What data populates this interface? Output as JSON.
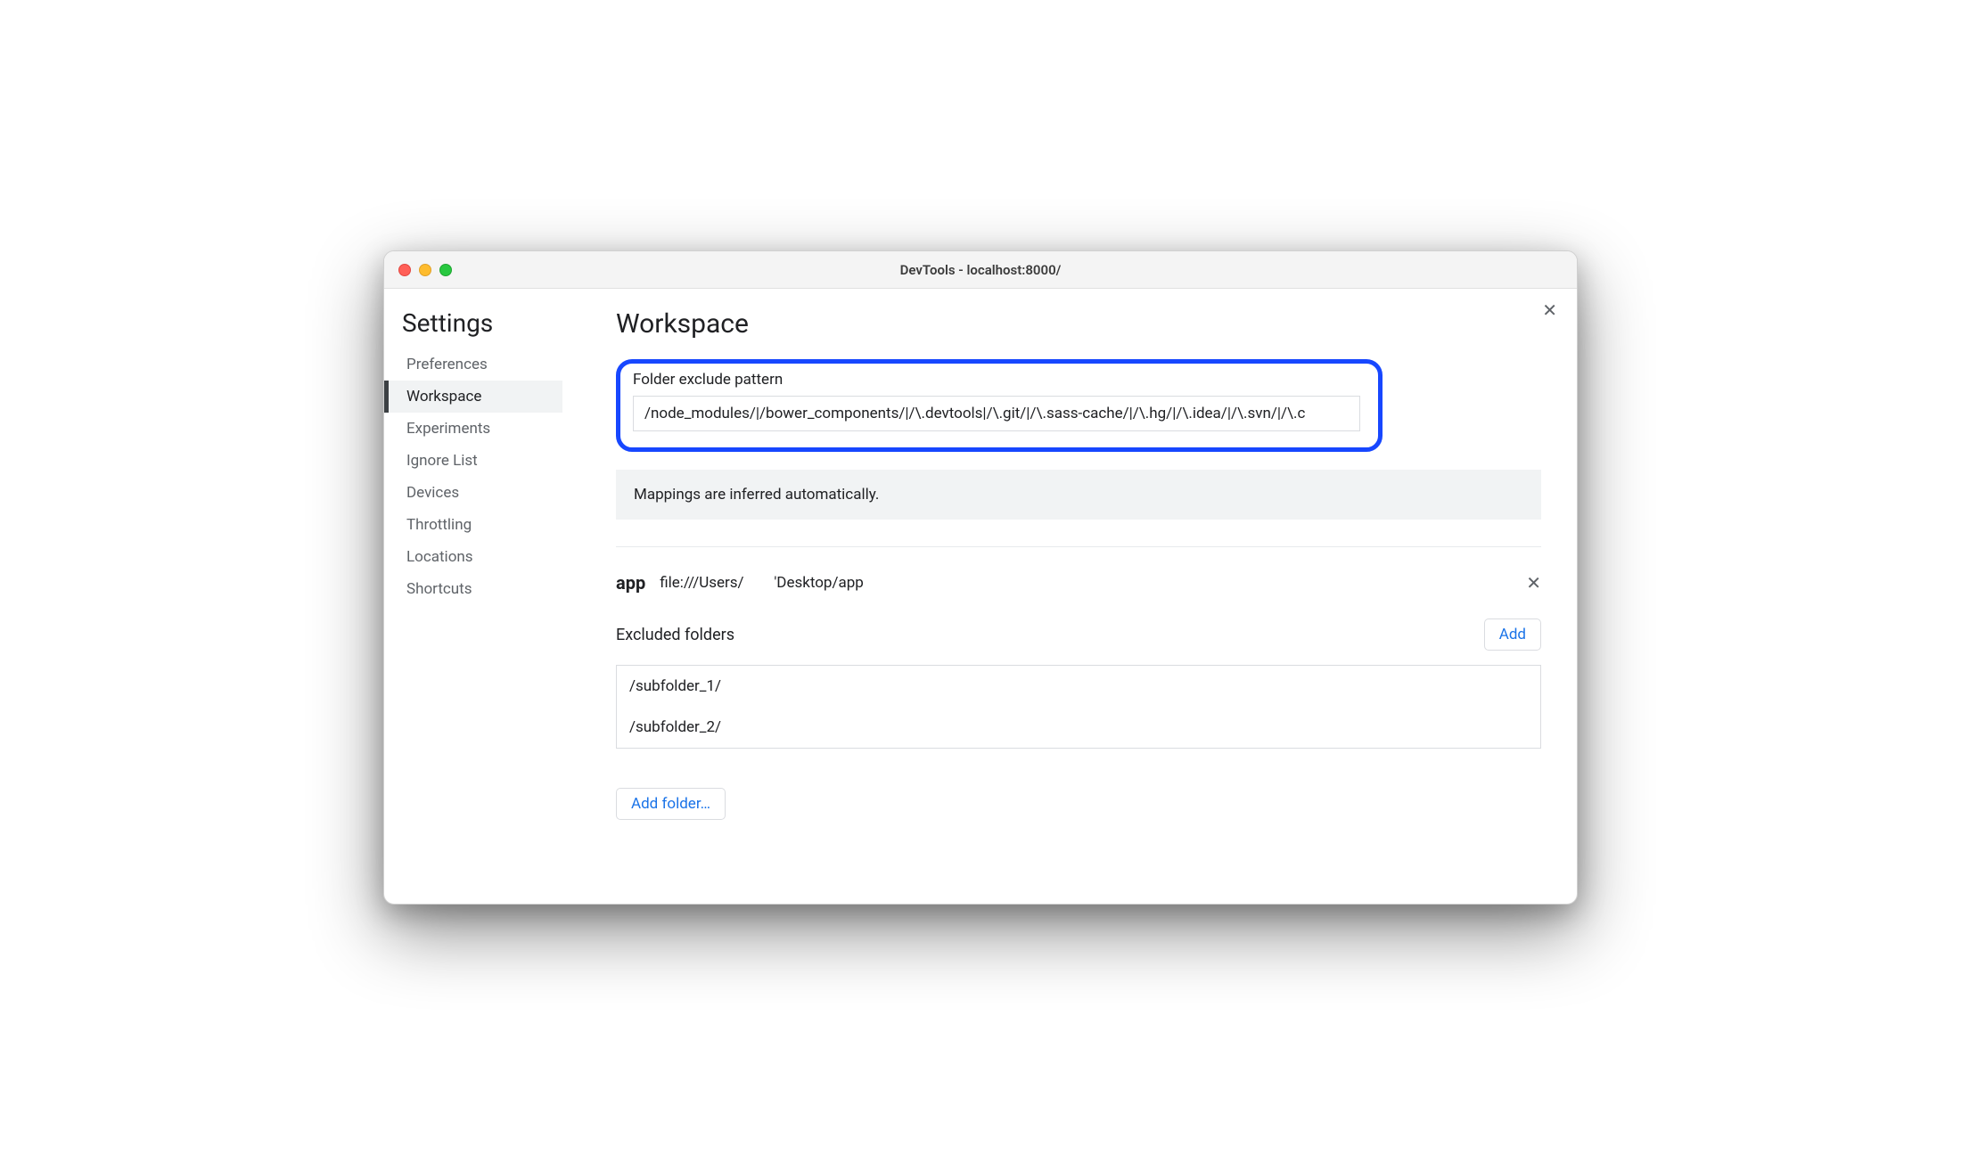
{
  "window": {
    "title": "DevTools - localhost:8000/"
  },
  "sidebar": {
    "title": "Settings",
    "items": [
      {
        "label": "Preferences"
      },
      {
        "label": "Workspace"
      },
      {
        "label": "Experiments"
      },
      {
        "label": "Ignore List"
      },
      {
        "label": "Devices"
      },
      {
        "label": "Throttling"
      },
      {
        "label": "Locations"
      },
      {
        "label": "Shortcuts"
      }
    ]
  },
  "main": {
    "title": "Workspace",
    "exclude_pattern_label": "Folder exclude pattern",
    "exclude_pattern_value": "/node_modules/|/bower_components/|/\\.devtools|/\\.git/|/\\.sass-cache/|/\\.hg/|/\\.idea/|/\\.svn/|/\\.c",
    "info_message": "Mappings are inferred automatically.",
    "folder": {
      "name": "app",
      "path_prefix": "file:///Users/",
      "path_suffix": "'Desktop/app"
    },
    "excluded_folders_label": "Excluded folders",
    "add_button": "Add",
    "excluded_folders": [
      "/subfolder_1/",
      "/subfolder_2/"
    ],
    "add_folder_button": "Add folder…"
  },
  "icons": {
    "close": "✕"
  }
}
